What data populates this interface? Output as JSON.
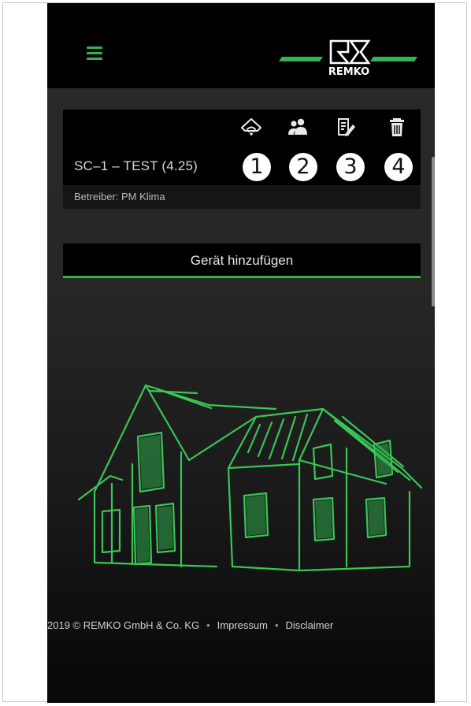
{
  "app": {
    "brand": "REMKO",
    "colors": {
      "accent": "#37b24d",
      "topbar": "#000000"
    }
  },
  "header": {
    "menu_icon": "hamburger-menu-icon",
    "logo_text": "REMKO"
  },
  "device_card": {
    "name": "SC–1 – TEST (4.25)",
    "operator": "Betreiber: PM Klima",
    "actions": [
      {
        "icon": "wifi-home-icon",
        "badge": "1"
      },
      {
        "icon": "users-icon",
        "badge": "2"
      },
      {
        "icon": "edit-document-icon",
        "badge": "3"
      },
      {
        "icon": "trash-icon",
        "badge": "4"
      }
    ]
  },
  "add_device": {
    "label": "Gerät hinzufügen"
  },
  "footer": {
    "copyright": "2019 © REMKO GmbH & Co. KG",
    "separator": "•",
    "impressum": "Impressum",
    "disclaimer": "Disclaimer"
  }
}
